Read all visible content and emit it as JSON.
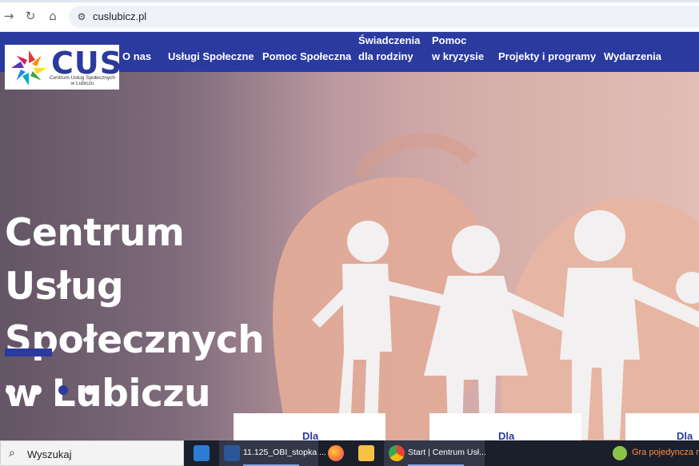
{
  "browser": {
    "back_icon": "arrow-right-icon",
    "reload_icon": "reload-icon",
    "home_icon": "home-icon",
    "site_settings_icon": "tune-icon",
    "url": "cuslubicz.pl"
  },
  "logo": {
    "text": "CUS",
    "subtitle_line1": "Centrum Usług Społecznych",
    "subtitle_line2": "w Lubiczu"
  },
  "nav": {
    "items": [
      {
        "label": "O nas"
      },
      {
        "label": "Usługi Społeczne"
      },
      {
        "label": "Pomoc Społeczna"
      },
      {
        "label_line1": "Świadczenia",
        "label_line2": "dla rodziny"
      },
      {
        "label_line1": "Pomoc",
        "label_line2": "w kryzysie"
      },
      {
        "label": "Projekty i programy"
      },
      {
        "label": "Wydarzenia"
      }
    ],
    "bg_color": "#2b3a9e"
  },
  "hero": {
    "title_line1": "Centrum Usług",
    "title_line2": "Społecznych",
    "title_line3": "w Lubiczu",
    "slides_count": 4,
    "active_slide": 3
  },
  "cards": [
    {
      "label": "Dla"
    },
    {
      "label": "Dla"
    },
    {
      "label": "Dla o"
    }
  ],
  "taskbar": {
    "search_placeholder": "Wyszukaj",
    "apps": [
      {
        "name": "mail-icon"
      },
      {
        "name": "word-icon",
        "label": "11.125_OBI_stopka ..."
      },
      {
        "name": "firefox-icon"
      },
      {
        "name": "file-explorer-icon"
      },
      {
        "name": "chrome-icon",
        "label": "Start | Centrum Usł..."
      }
    ],
    "game_text": "Gra pojedyncza n"
  }
}
